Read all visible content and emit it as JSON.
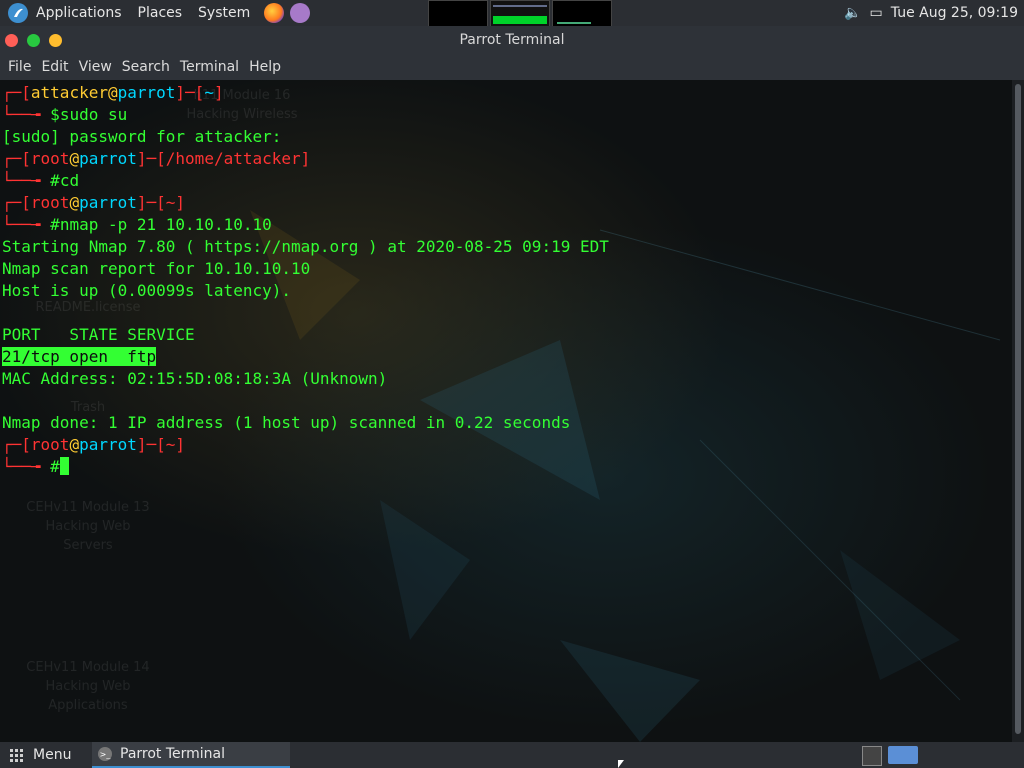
{
  "top_panel": {
    "applications": "Applications",
    "places": "Places",
    "system": "System",
    "datetime": "Tue Aug 25, 09:19",
    "icons": [
      "parrot-logo-icon",
      "firefox-icon",
      "terminal-icon",
      "text-editor-icon",
      "volume-icon",
      "display-icon"
    ]
  },
  "window": {
    "title": "Parrot Terminal",
    "menu": [
      "File",
      "Edit",
      "View",
      "Search",
      "Terminal",
      "Help"
    ]
  },
  "terminal": {
    "prompt1": {
      "user": "attacker",
      "host": "parrot",
      "path": "~",
      "sym": "$",
      "cmd": "sudo su"
    },
    "sudo_line": "[sudo] password for attacker:",
    "prompt2": {
      "user": "root",
      "host": "parrot",
      "path": "/home/attacker",
      "sym": "#",
      "cmd": "cd"
    },
    "prompt3": {
      "user": "root",
      "host": "parrot",
      "path": "~",
      "sym": "#",
      "cmd": "nmap -p 21 10.10.10.10"
    },
    "out1": "Starting Nmap 7.80 ( https://nmap.org ) at 2020-08-25 09:19 EDT",
    "out2": "Nmap scan report for 10.10.10.10",
    "out3": "Host is up (0.00099s latency).",
    "out4": "PORT   STATE SERVICE",
    "out5": "21/tcp open  ftp",
    "out6": "MAC Address: 02:15:5D:08:18:3A (Unknown)",
    "out7": "Nmap done: 1 IP address (1 host up) scanned in 0.22 seconds",
    "prompt4": {
      "user": "root",
      "host": "parrot",
      "path": "~",
      "sym": "#"
    }
  },
  "desktop": {
    "labels": [
      "h11 Module 16",
      "Hacking Wireless",
      "README.license",
      "Trash",
      "CEHv11 Module 13",
      "Hacking Web",
      "Servers",
      "CEHv11 Module 14",
      "Hacking Web",
      "Applications"
    ]
  },
  "taskbar": {
    "menu": "Menu",
    "task": "Parrot Terminal"
  },
  "colors": {
    "prompt_bracket": "#ff3333",
    "prompt_host": "#00d8ff",
    "output_green": "#33ff33"
  }
}
